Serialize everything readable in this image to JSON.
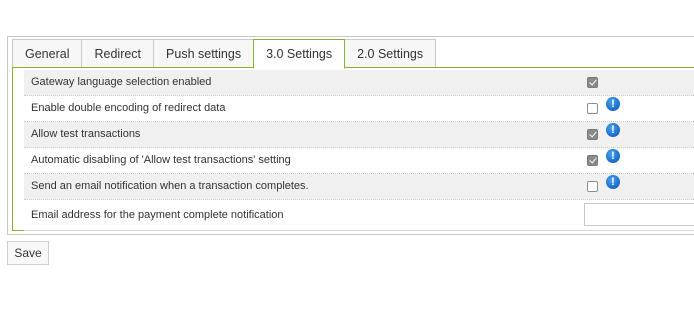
{
  "tabs": [
    "General",
    "Redirect",
    "Push settings",
    "3.0 Settings",
    "2.0 Settings"
  ],
  "active_tab": "3.0 Settings",
  "settings": [
    {
      "label": "Gateway language selection enabled",
      "checked": true,
      "info": false
    },
    {
      "label": "Enable double encoding of redirect data",
      "checked": false,
      "info": true
    },
    {
      "label": "Allow test transactions",
      "checked": true,
      "info": true
    },
    {
      "label": "Automatic disabling of 'Allow test transactions' setting",
      "checked": true,
      "info": true
    },
    {
      "label": "Send an email notification when a transaction completes.",
      "checked": false,
      "info": true
    }
  ],
  "email_setting": {
    "label": "Email address for the payment complete notification",
    "value": "",
    "placeholder": ""
  },
  "info_glyph": "!",
  "save_label": "Save",
  "colors": {
    "accent_border": "#86b32d",
    "row_alt": "#f0f0f0",
    "info_icon": "#1769c7"
  }
}
